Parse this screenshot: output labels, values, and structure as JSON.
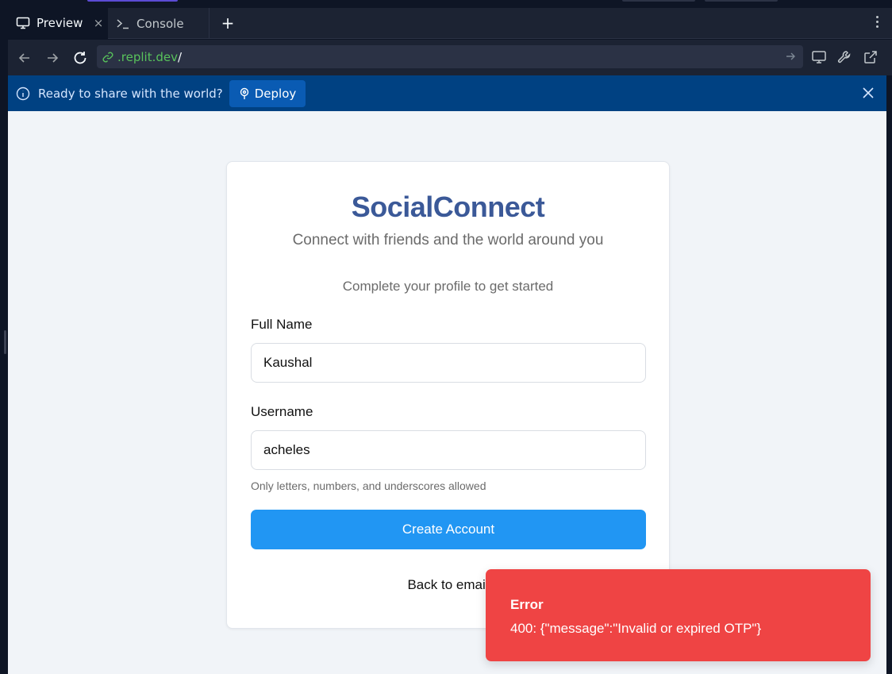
{
  "tabs": {
    "preview_label": "Preview",
    "console_label": "Console",
    "close_glyph": "×",
    "add_glyph": "+"
  },
  "address_bar": {
    "host": ".replit.dev",
    "path": "/"
  },
  "banner": {
    "text": "Ready to share with the world?",
    "deploy_label": "Deploy"
  },
  "app": {
    "brand": "SocialConnect",
    "tagline": "Connect with friends and the world around you",
    "step_text": "Complete your profile to get started",
    "full_name_label": "Full Name",
    "full_name_value": "Kaushal",
    "username_label": "Username",
    "username_value": "acheles",
    "username_hint": "Only letters, numbers, and underscores allowed",
    "create_button": "Create Account",
    "back_link": "Back to email"
  },
  "toast": {
    "title": "Error",
    "message": "400: {\"message\":\"Invalid or expired OTP\"}"
  },
  "colors": {
    "brand": "#3b5998",
    "primary_button": "#2196f3",
    "error_toast": "#ef4444",
    "banner": "#004182",
    "url_host": "#58c25b"
  },
  "icons": [
    "monitor-icon",
    "terminal-icon",
    "close-icon",
    "plus-icon",
    "kebab-menu-icon",
    "back-arrow-icon",
    "forward-arrow-icon",
    "reload-icon",
    "link-icon",
    "go-arrow-icon",
    "device-icon",
    "wrench-icon",
    "external-link-icon",
    "info-icon",
    "deploy-icon"
  ]
}
